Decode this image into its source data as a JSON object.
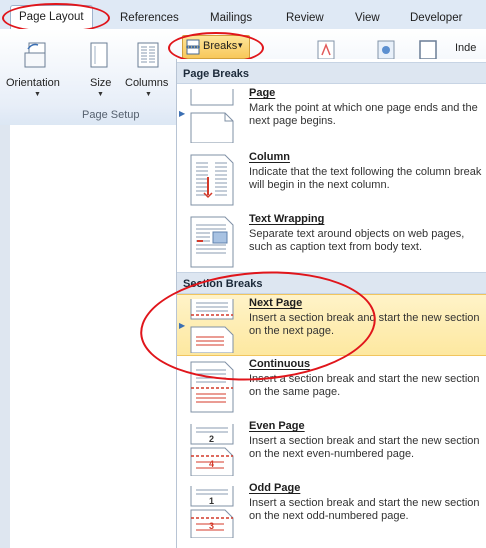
{
  "tabs": [
    "Page Layout",
    "References",
    "Mailings",
    "Review",
    "View",
    "Developer"
  ],
  "ribbon": {
    "orientation": "Orientation",
    "size": "Size",
    "columns": "Columns",
    "breaks": "Breaks",
    "breaks_caret": "▾",
    "indent": "Inde",
    "group_label": "Page Setup"
  },
  "menu": {
    "page_breaks_header": "Page Breaks",
    "section_breaks_header": "Section Breaks",
    "items": [
      {
        "title": "Page",
        "desc": "Mark the point at which one page ends and the next page begins.",
        "icon": "page-break-icon"
      },
      {
        "title": "Column",
        "desc": "Indicate that the text following the column break will begin in the next column.",
        "icon": "column-break-icon"
      },
      {
        "title": "Text Wrapping",
        "desc": "Separate text around objects on web pages, such as caption text from body text.",
        "icon": "text-wrapping-break-icon"
      },
      {
        "title": "Next Page",
        "desc": "Insert a section break and start the new section on the next page.",
        "icon": "next-page-break-icon"
      },
      {
        "title": "Continuous",
        "desc": "Insert a section break and start the new section on the same page.",
        "icon": "continuous-break-icon"
      },
      {
        "title": "Even Page",
        "desc": "Insert a section break and start the new section on the next even-numbered page.",
        "icon": "even-page-break-icon",
        "numbers": [
          "2",
          "4"
        ]
      },
      {
        "title": "Odd Page",
        "desc": "Insert a section break and start the new section on the next odd-numbered page.",
        "icon": "odd-page-break-icon",
        "numbers": [
          "1",
          "3"
        ]
      }
    ]
  },
  "colors": {
    "annotation_red": "#e0151b",
    "highlight": "#fde8a0",
    "tab_bar": "#dfe9f5"
  }
}
